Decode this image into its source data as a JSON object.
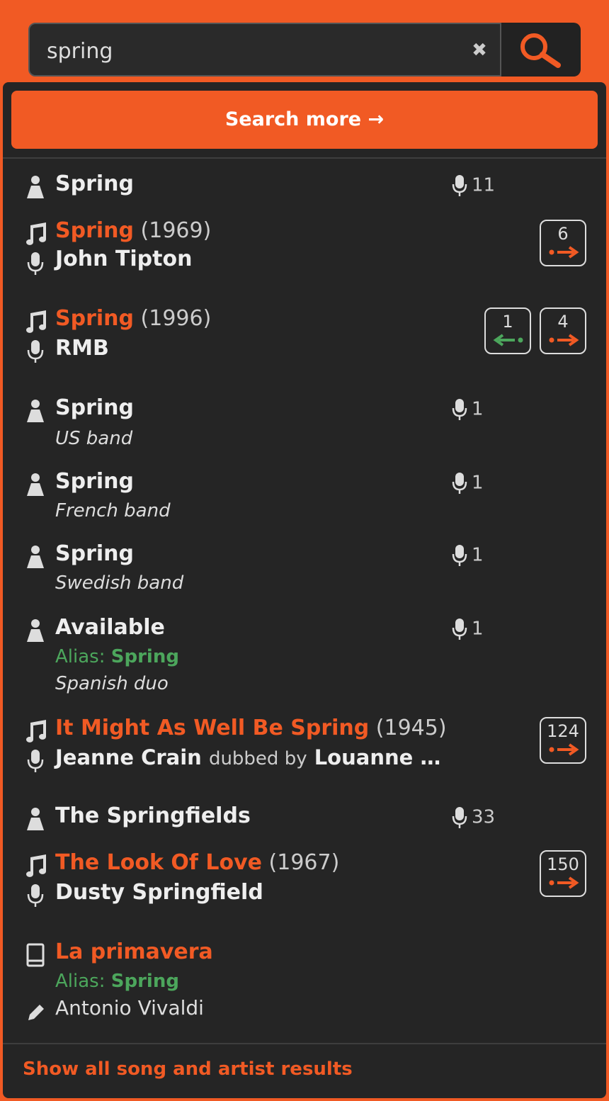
{
  "search": {
    "query": "spring",
    "clear_label": "✖"
  },
  "search_more_label": "Search more →",
  "results": [
    {
      "kind": "artist",
      "name": "Spring",
      "count": "11"
    },
    {
      "kind": "song",
      "title": "Spring",
      "year": "(1969)",
      "artist": "John Tipton",
      "forward_count": "6"
    },
    {
      "kind": "song",
      "title": "Spring",
      "year": "(1996)",
      "artist": "RMB",
      "back_count": "1",
      "forward_count": "4"
    },
    {
      "kind": "artist",
      "name": "Spring",
      "description": "US band",
      "count": "1"
    },
    {
      "kind": "artist",
      "name": "Spring",
      "description": "French band",
      "count": "1"
    },
    {
      "kind": "artist",
      "name": "Spring",
      "description": "Swedish band",
      "count": "1"
    },
    {
      "kind": "artist",
      "name": "Available",
      "alias_label": "Alias:",
      "alias": "Spring",
      "description": "Spanish duo",
      "count": "1"
    },
    {
      "kind": "song",
      "title": "It Might As Well Be Spring",
      "year": "(1945)",
      "artist": "Jeanne Crain",
      "dubbed_label": "dubbed by",
      "dubbed_artist": "Louanne …",
      "forward_count": "124"
    },
    {
      "kind": "artist",
      "name": "The Springfields",
      "count": "33"
    },
    {
      "kind": "song",
      "title": "The Look Of Love",
      "year": "(1967)",
      "artist": "Dusty Springfield",
      "forward_count": "150"
    },
    {
      "kind": "work",
      "title": "La primavera",
      "alias_label": "Alias:",
      "alias": "Spring",
      "composer": "Antonio Vivaldi"
    }
  ],
  "footer_link": "Show all song and artist results",
  "colors": {
    "accent": "#f15a24",
    "panel": "#252525",
    "alias_green": "#4ca65c"
  },
  "icons": [
    "clear-icon",
    "magnifier-icon",
    "person-icon",
    "music-note-icon",
    "microphone-icon",
    "book-icon",
    "pencil-icon",
    "arrow-right-icon",
    "arrow-left-icon"
  ]
}
